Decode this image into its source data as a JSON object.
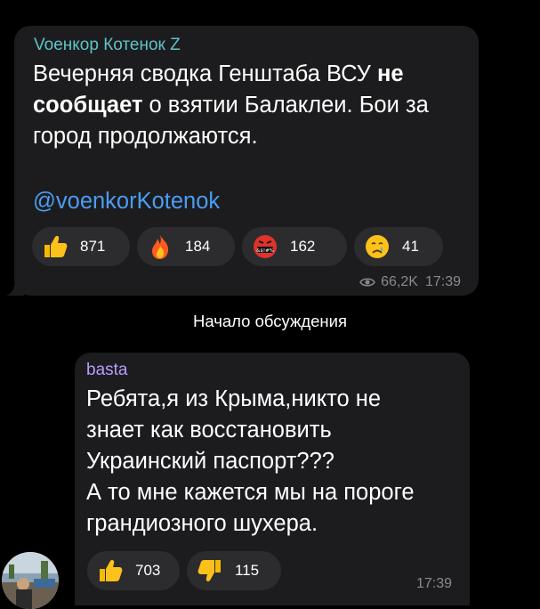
{
  "channel_post": {
    "author": "Voенкор Котенок Z",
    "text_lines": [
      {
        "pre": "Вечерняя сводка Генштаба ВСУ ",
        "bold": "не"
      },
      {
        "bold": "сообщает",
        "post": " о взятии Балаклеи. Бои за"
      },
      {
        "pre": "город продолжаются."
      }
    ],
    "mention": "@voenkorKotenok",
    "reactions": [
      {
        "icon": "thumbs-up-icon",
        "count": "871"
      },
      {
        "icon": "fire-icon",
        "count": "184"
      },
      {
        "icon": "swearing-face-icon",
        "count": "162"
      },
      {
        "icon": "crying-face-icon",
        "count": "41"
      }
    ],
    "views": "66,2K",
    "time": "17:39"
  },
  "divider": {
    "label": "Начало обсуждения"
  },
  "reply": {
    "author": "basta",
    "lines": [
      "Ребята,я из Крыма,никто не",
      "знает как восстановить",
      "Украинский паспорт???",
      "А то мне кажется мы на пороге",
      "грандиозного шухера."
    ],
    "reactions": [
      {
        "icon": "thumbs-up-icon",
        "count": "703"
      },
      {
        "icon": "thumbs-down-icon",
        "count": "115"
      }
    ],
    "time": "17:39"
  },
  "colors": {
    "background": "#000000",
    "bubble": "#1c1c1e",
    "reaction_pill": "#2c2c2e",
    "channel_author": "#5ec4c9",
    "reply_author": "#b89cff",
    "link": "#4a9df5",
    "meta": "#8a8a8e"
  }
}
